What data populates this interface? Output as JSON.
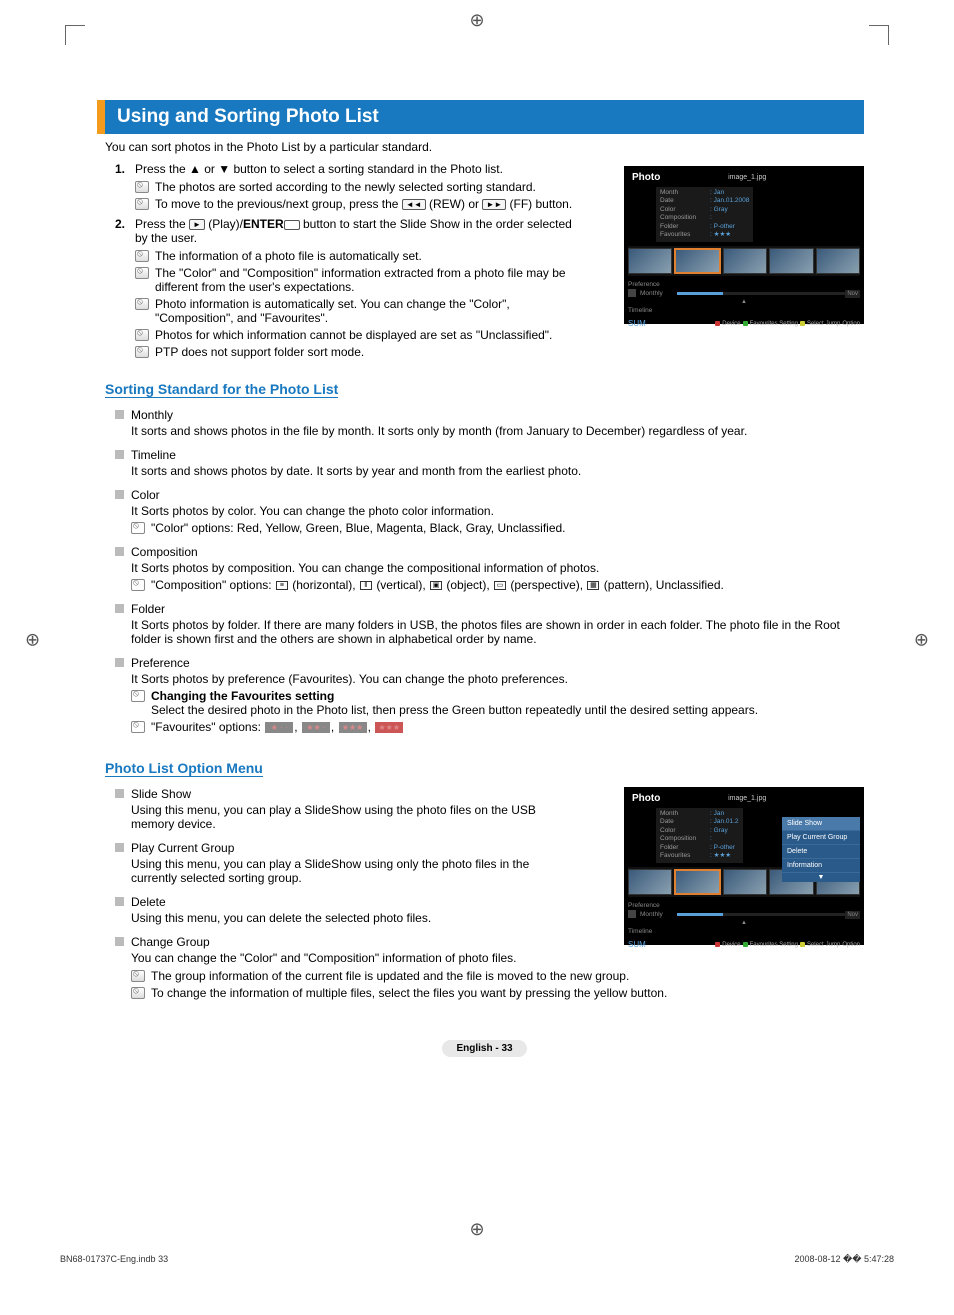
{
  "title": "Using and Sorting Photo List",
  "intro": "You can sort photos in the Photo List by a particular standard.",
  "steps": [
    {
      "num": "1.",
      "text_pre": "Press the ▲ or ▼ button to select a sorting standard in the Photo list.",
      "notes": [
        "The photos are sorted according to the newly selected sorting standard.",
        "To move to the previous/next group, press the ◄◄ (REW) or ►► (FF) button."
      ]
    },
    {
      "num": "2.",
      "text_pre": "Press the ► (Play)/ENTER⏎ button to start the Slide Show in the order selected by the user.",
      "notes": [
        "The information of a photo file is automatically set.",
        "The \"Color\" and \"Composition\" information extracted from a photo file may be different from the user's expectations.",
        "Photo information is automatically set. You can change the \"Color\", \"Composition\", and \"Favourites\".",
        "Photos for which information cannot be displayed are set as \"Unclassified\".",
        "PTP does not support folder sort mode."
      ]
    }
  ],
  "sorting_heading": "Sorting Standard for the Photo List",
  "sorting_items": [
    {
      "title": "Monthly",
      "desc": "It sorts and shows photos in the file by month. It sorts only by month (from January to December) regardless of year."
    },
    {
      "title": "Timeline",
      "desc": "It sorts and shows photos by date. It sorts by year and month from the earliest photo."
    },
    {
      "title": "Color",
      "desc": "It Sorts photos by color. You can change the photo color information.",
      "note": "\"Color\" options: Red, Yellow, Green, Blue, Magenta, Black, Gray, Unclassified."
    },
    {
      "title": "Composition",
      "desc": "It Sorts photos by composition. You can change the compositional information of photos.",
      "comp_note_prefix": "\"Composition\" options: ",
      "comp_opts": [
        "(horizontal),",
        "(vertical),",
        "(object),",
        "(perspective),",
        "(pattern), Unclassified."
      ]
    },
    {
      "title": "Folder",
      "desc": "It Sorts photos by folder. If there are many folders in USB, the photos files are shown in order in each folder. The photo file in the Root folder is shown first and the others are shown in alphabetical order by name."
    },
    {
      "title": "Preference",
      "desc": "It Sorts photos by preference (Favourites). You can change the photo preferences.",
      "pref_note1_title": "Changing the Favourites setting",
      "pref_note1_body": "Select the desired photo in the Photo list, then press the Green button repeatedly until the desired setting appears.",
      "pref_note2": "\"Favourites\" options: "
    }
  ],
  "option_heading": "Photo List Option Menu",
  "option_items": [
    {
      "title": "Slide Show",
      "desc": "Using this menu, you can play a SlideShow using the photo files on the USB memory device."
    },
    {
      "title": "Play Current Group",
      "desc": "Using this menu, you can play a SlideShow using only the photo files in the currently selected sorting group."
    },
    {
      "title": "Delete",
      "desc": "Using this menu, you can delete the selected photo files."
    },
    {
      "title": "Change Group",
      "desc": "You can change the \"Color\" and \"Composition\" information of photo files.",
      "notes": [
        "The group information of the current file is updated and the file is moved to the new group.",
        "To change the information of multiple files, select the files you want by pressing the yellow button."
      ]
    }
  ],
  "screenshot": {
    "label": "Photo",
    "filename": "image_1.jpg",
    "info": {
      "Month": ": Jan",
      "Date": ": Jan.01.2008",
      "Color": ": Gray",
      "Composition": ":",
      "Folder": ": P-other",
      "Favourites": ": ★★★"
    },
    "nav": {
      "preference": "Preference",
      "monthly": "Monthly",
      "timeline": "Timeline",
      "nov": "Nov"
    },
    "sum": "SUM",
    "footer_btns": [
      "Device",
      "Favourites Setting",
      "Select",
      "Jump",
      "Option"
    ],
    "menu": [
      "Slide Show",
      "Play Current Group",
      "Delete",
      "Information"
    ]
  },
  "page_number": "English - 33",
  "footer": {
    "left": "BN68-01737C-Eng.indb   33",
    "right": "2008-08-12   �� 5:47:28"
  }
}
